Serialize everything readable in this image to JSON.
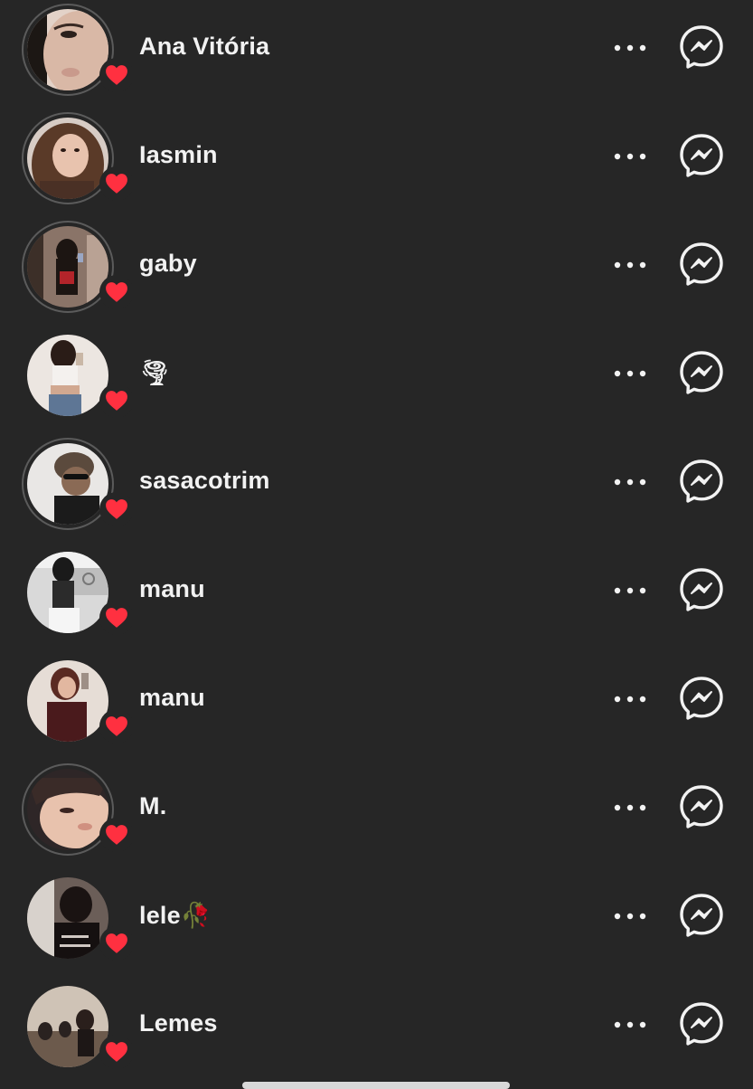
{
  "likes_list": {
    "users": [
      {
        "username": "Ana Vitória",
        "avatar": "profile-photo",
        "liked": true
      },
      {
        "username": "Iasmin",
        "avatar": "profile-photo",
        "liked": true
      },
      {
        "username": "gaby",
        "avatar": "profile-photo",
        "liked": true
      },
      {
        "username": "🌪",
        "avatar": "profile-photo",
        "liked": true
      },
      {
        "username": "sasacotrim",
        "avatar": "profile-photo",
        "liked": true
      },
      {
        "username": "manu",
        "avatar": "profile-photo",
        "liked": true
      },
      {
        "username": "manu",
        "avatar": "profile-photo",
        "liked": true
      },
      {
        "username": "M.",
        "avatar": "profile-photo",
        "liked": true
      },
      {
        "username": "lele🥀",
        "avatar": "profile-photo",
        "liked": true
      },
      {
        "username": "Lemes",
        "avatar": "profile-photo",
        "liked": true
      }
    ],
    "icons": {
      "like_badge": "heart-icon",
      "more": "more-options-icon",
      "message": "messenger-icon"
    },
    "colors": {
      "background": "#262626",
      "heart": "#ff3040",
      "text": "#f2f2f2",
      "ring": "#5b5b5b"
    }
  }
}
